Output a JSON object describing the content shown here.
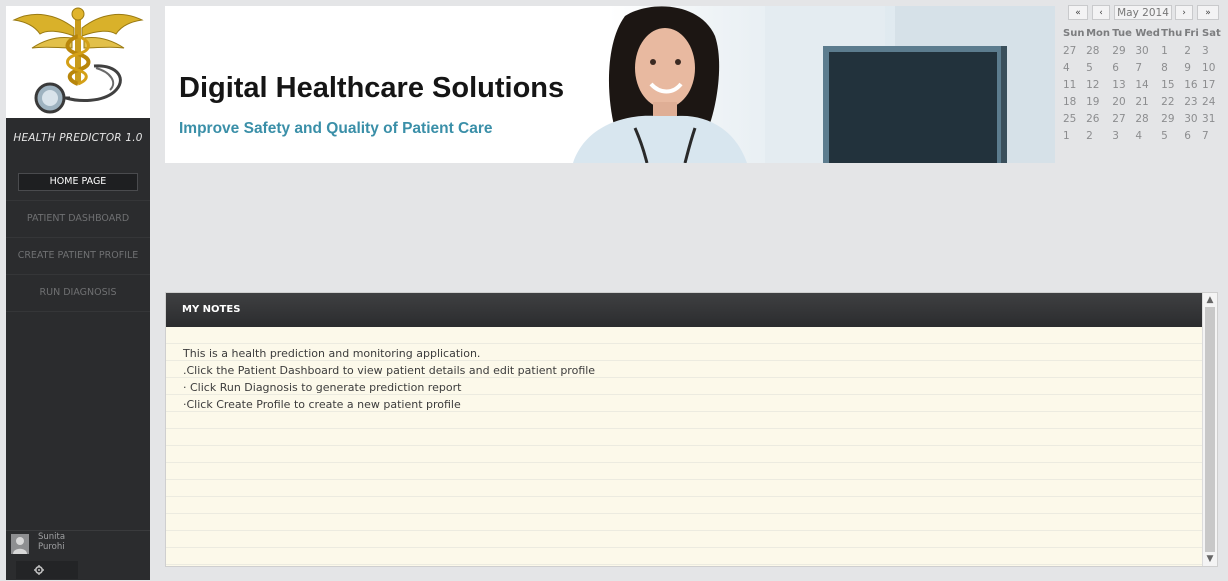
{
  "app": {
    "title": "HEALTH PREDICTOR 1.0",
    "logo_icon": "caduceus-stethoscope-icon"
  },
  "sidebar": {
    "items": [
      {
        "label": "HOME PAGE",
        "active": true
      },
      {
        "label": "PATIENT DASHBOARD",
        "active": false
      },
      {
        "label": "CREATE PATIENT PROFILE",
        "active": false
      },
      {
        "label": "RUN DIAGNOSIS",
        "active": false
      }
    ],
    "user": {
      "first_name": "Sunita",
      "last_name": "Purohi",
      "avatar_icon": "user-silhouette-icon",
      "settings_icon": "gear-icon"
    }
  },
  "banner": {
    "title": "Digital Healthcare Solutions",
    "subtitle": "Improve Safety and Quality of Patient Care"
  },
  "calendar": {
    "prev_year": "«",
    "prev_month": "‹",
    "month_label": "May 2014",
    "next_month": "›",
    "next_year": "»",
    "weekdays": [
      "Sun",
      "Mon",
      "Tue",
      "Wed",
      "Thu",
      "Fri",
      "Sat"
    ],
    "weeks": [
      [
        "27",
        "28",
        "29",
        "30",
        "1",
        "2",
        "3"
      ],
      [
        "4",
        "5",
        "6",
        "7",
        "8",
        "9",
        "10"
      ],
      [
        "11",
        "12",
        "13",
        "14",
        "15",
        "16",
        "17"
      ],
      [
        "18",
        "19",
        "20",
        "21",
        "22",
        "23",
        "24"
      ],
      [
        "25",
        "26",
        "27",
        "28",
        "29",
        "30",
        "31"
      ],
      [
        "1",
        "2",
        "3",
        "4",
        "5",
        "6",
        "7"
      ]
    ]
  },
  "notes": {
    "header": "MY NOTES",
    "lines": [
      "This is a health prediction and monitoring application.",
      ".Click the Patient Dashboard to view patient details and edit patient profile",
      "· Click Run Diagnosis to generate prediction report",
      "·Click Create Profile to create a new patient profile"
    ]
  },
  "colors": {
    "sidebar_bg": "#2b2c2e",
    "page_bg": "#e4e5e7",
    "notes_bg": "#fcf9ea",
    "subtitle_accent": "#3a8fa8"
  }
}
